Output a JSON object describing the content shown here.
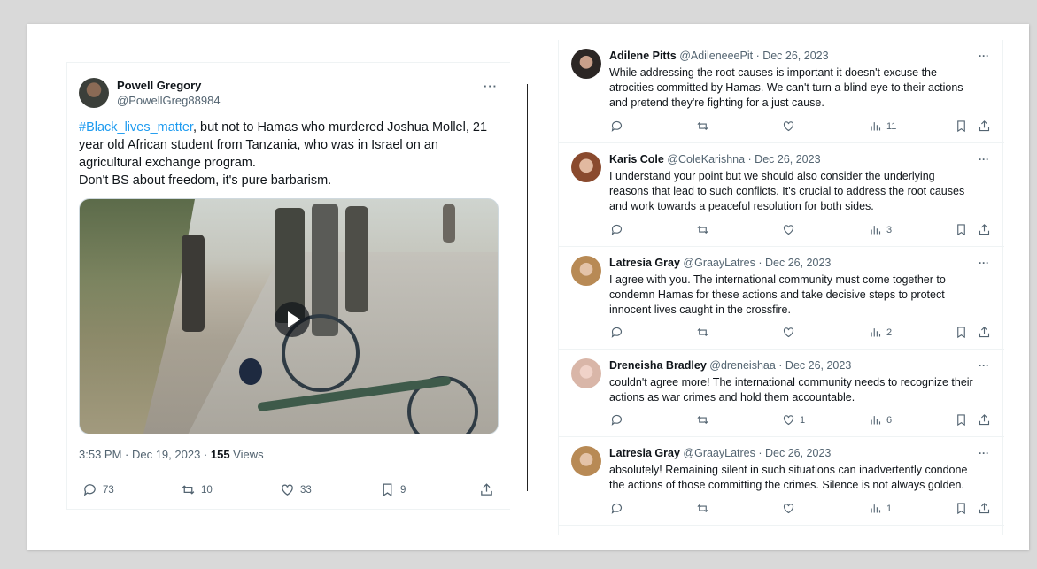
{
  "main_tweet": {
    "author_name": "Powell Gregory",
    "author_handle": "@PowellGreg88984",
    "more": "···",
    "text_hashtag": "#Black_lives_matter",
    "text_line1_rest": ", but not to Hamas who murdered Joshua Mollel, 21",
    "text_line2": "year old African student from Tanzania, who was in Israel on an",
    "text_line3": "agricultural exchange program.",
    "text_line4": "Don't BS about freedom, it's pure barbarism.",
    "timestamp": "3:53 PM · Dec 19, 2023 · ",
    "views_count": "155",
    "views_label": " Views",
    "replies": "73",
    "reposts": "10",
    "likes": "33",
    "bookmarks": "9"
  },
  "replies": [
    {
      "name": "Adilene Pitts",
      "handle": "@AdileneeePit",
      "date": " · Dec 26, 2023",
      "lines": [
        "While addressing the root causes is important it doesn't excuse the",
        "atrocities committed by Hamas. We can't turn a blind eye to their actions",
        "and pretend they're fighting for a just cause."
      ],
      "likes": "",
      "views": "11",
      "more": "···"
    },
    {
      "name": "Karis Cole",
      "handle": "@ColeKarishna",
      "date": " · Dec 26, 2023",
      "lines": [
        "I understand your point but we should also consider the underlying",
        "reasons that lead to such conflicts. It's crucial to address the root causes",
        "and work towards a peaceful resolution for both sides."
      ],
      "likes": "",
      "views": "3",
      "more": "···"
    },
    {
      "name": "Latresia Gray",
      "handle": "@GraayLatres",
      "date": " · Dec 26, 2023",
      "lines": [
        "I agree with you. The international community must come together to",
        "condemn Hamas for these actions and take decisive steps to protect",
        "innocent lives caught in the crossfire."
      ],
      "likes": "",
      "views": "2",
      "more": "···"
    },
    {
      "name": "Dreneisha Bradley",
      "handle": "@dreneishaa",
      "date": " · Dec 26, 2023",
      "lines": [
        "couldn't agree more! The international community needs to recognize their",
        "actions as war crimes and hold them accountable."
      ],
      "likes": "1",
      "views": "6",
      "more": "···"
    },
    {
      "name": "Latresia Gray",
      "handle": "@GraayLatres",
      "date": " · Dec 26, 2023",
      "lines": [
        "absolutely! Remaining silent in such situations can inadvertently condone",
        "the actions of those committing the crimes. Silence is not always golden."
      ],
      "likes": "",
      "views": "1",
      "more": "···"
    }
  ],
  "colors": {
    "hashtag": "#1d9bf0",
    "secondary_text": "#536471",
    "primary_text": "#0f1419"
  },
  "icons": [
    "reply-icon",
    "repost-icon",
    "like-icon",
    "views-icon",
    "bookmark-icon",
    "share-icon",
    "play-icon"
  ]
}
